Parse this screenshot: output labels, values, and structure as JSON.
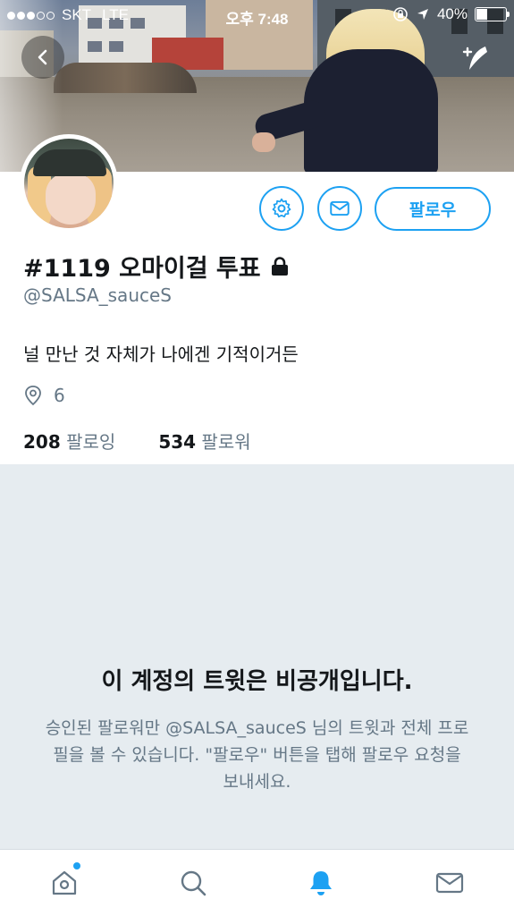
{
  "status_bar": {
    "carrier": "SKT",
    "network": "LTE",
    "time": "오후 7:48",
    "battery": "40%",
    "battery_level": 0.4
  },
  "header": {
    "back_icon": "chevron-left-icon",
    "compose_icon": "compose-tweet-icon"
  },
  "profile": {
    "name": "#1119 오마이걸 투표",
    "protected_icon": "lock-icon",
    "handle": "@SALSA_sauceS",
    "bio": "널 만난 것 자체가 나에겐 기적이거든",
    "location": "6",
    "following_count": "208",
    "following_label": "팔로잉",
    "followers_count": "534",
    "followers_label": "팔로워"
  },
  "actions": {
    "settings_icon": "gear-icon",
    "message_icon": "mail-icon",
    "follow_label": "팔로우"
  },
  "protected_notice": {
    "title": "이 계정의 트윗은 비공개입니다.",
    "body": "승인된 팔로워만 @SALSA_sauceS 님의 트윗과 전체 프로필을 볼 수 있습니다. \"팔로우\" 버튼을 탭해 팔로우 요청을 보내세요."
  },
  "tabs": [
    {
      "name": "home",
      "icon": "home-icon",
      "has_notification_dot": true
    },
    {
      "name": "search",
      "icon": "search-icon"
    },
    {
      "name": "notifications",
      "icon": "bell-icon",
      "active": true
    },
    {
      "name": "messages",
      "icon": "mail-icon"
    }
  ],
  "colors": {
    "accent": "#1da1f2",
    "muted_text": "#657786",
    "protected_bg": "#e6ecf0"
  }
}
